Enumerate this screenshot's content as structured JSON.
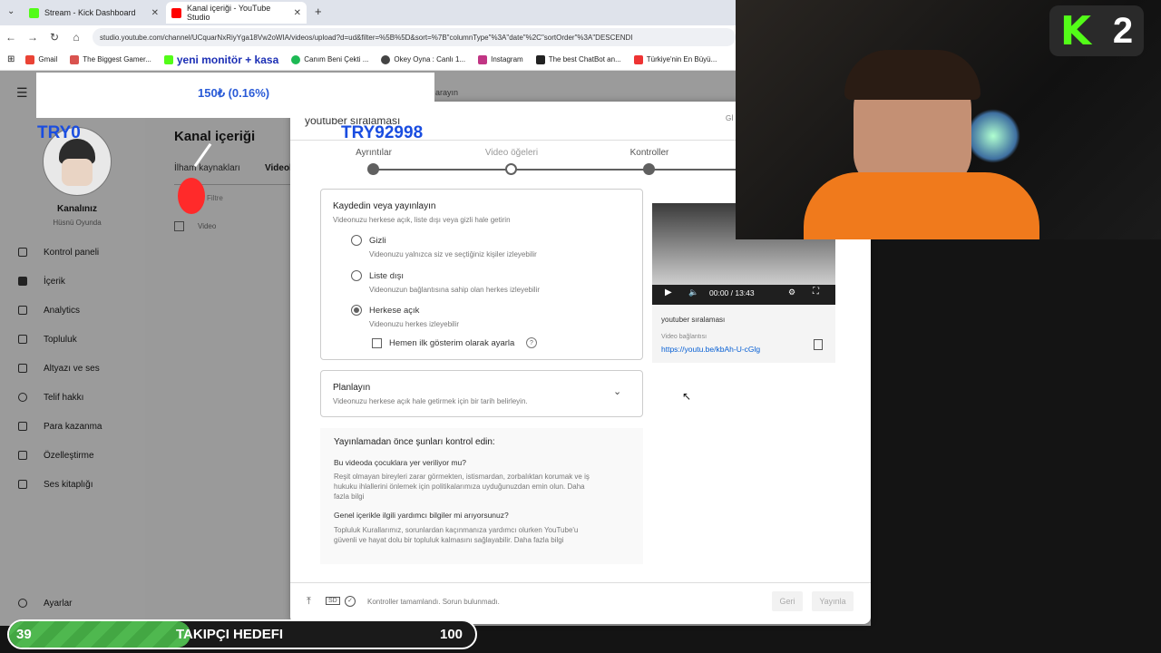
{
  "tabs": [
    {
      "label": "Stream - Kick Dashboard",
      "color": "#53fc18"
    },
    {
      "label": "Kanal içeriği - YouTube Studio",
      "color": "#ff0000"
    }
  ],
  "address": "studio.youtube.com/channel/UCquarNxRiyYga18Vw2oWIA/videos/upload?d=ud&filter=%5B%5D&sort=%7B\"columnType\"%3A\"date\"%2C\"sortOrder\"%3A\"DESCENDI",
  "bookmarks": [
    "Gmail",
    "The Biggest Gamer...",
    "yeni monitör + kasa",
    "Canım Beni Çekti ...",
    "Okey Oyna : Canlı 1...",
    "Instagram",
    "The best ChatBot an...",
    "Türkiye'nin En Büyü..."
  ],
  "overlay": {
    "donation": "150₺ (0.16%)",
    "try_small": "TRY0",
    "try_big": "TRY92998"
  },
  "goal": {
    "current": "39",
    "label": "TAKIPÇI HEDEFI",
    "target": "100",
    "progress": 0.39
  },
  "channel": {
    "name": "Kanalınız",
    "handle": "Hüsnü Oyunda"
  },
  "studio": {
    "page_title": "Kanal içeriği",
    "tabs": [
      "İlham kaynakları",
      "Videol"
    ],
    "filter": "Filtre",
    "col_video": "Video",
    "search_hint": "arayın"
  },
  "sidebar": [
    {
      "label": "Kontrol paneli",
      "icon": "dashboard-icon"
    },
    {
      "label": "İçerik",
      "icon": "content-icon"
    },
    {
      "label": "Analytics",
      "icon": "analytics-icon"
    },
    {
      "label": "Topluluk",
      "icon": "community-icon"
    },
    {
      "label": "Altyazı ve ses",
      "icon": "subtitles-icon"
    },
    {
      "label": "Telif hakkı",
      "icon": "copyright-icon"
    },
    {
      "label": "Para kazanma",
      "icon": "money-icon"
    },
    {
      "label": "Özelleştirme",
      "icon": "customize-icon"
    },
    {
      "label": "Ses kitaplığı",
      "icon": "audio-library-icon"
    }
  ],
  "settings_label": "Ayarlar",
  "dialog": {
    "title": "youtuber sıralaması",
    "title_right": "Gİ",
    "steps": [
      "Ayrıntılar",
      "Video öğeleri",
      "Kontroller",
      ""
    ],
    "visibility": {
      "title": "Kaydedin veya yayınlayın",
      "subtitle": "Videonuzu herkese açık, liste dışı veya gizli hale getirin",
      "options": [
        {
          "label": "Gizli",
          "desc": "Videonuzu yalnızca siz ve seçtiğiniz kişiler izleyebilir"
        },
        {
          "label": "Liste dışı",
          "desc": "Videonuzun bağlantısına sahip olan herkes izleyebilir"
        },
        {
          "label": "Herkese açık",
          "desc": "Videonuzu herkes izleyebilir"
        }
      ],
      "premiere": "Hemen ilk gösterim olarak ayarla"
    },
    "schedule": {
      "title": "Planlayın",
      "desc": "Videonuzu herkese açık hale getirmek için bir tarih belirleyin."
    },
    "checks": {
      "title": "Yayınlamadan önce şunları kontrol edin:",
      "q1": "Bu videoda çocuklara yer veriliyor mu?",
      "a1": "Reşit olmayan bireyleri zarar görmekten, istismardan, zorbalıktan korumak ve iş hukuku ihlallerini önlemek için politikalarımıza uyduğunuzdan emin olun. Daha fazla bilgi",
      "q2": "Genel içerikle ilgili yardımcı bilgiler mi arıyorsunuz?",
      "a2": "Topluluk Kurallarımız, sorunlardan kaçınmanıza yardımcı olurken YouTube'u güvenli ve hayat dolu bir topluluk kalmasını sağlayabilir. Daha fazla bilgi"
    },
    "preview": {
      "time": "00:00 / 13:43",
      "filename": "youtuber sıralaması",
      "link_label": "Video bağlantısı",
      "link": "https://youtu.be/kbAh-U-cGlg"
    },
    "footer": {
      "status": "Kontroller tamamlandı. Sorun bulunmadı.",
      "back": "Geri",
      "publish": "Yayınla",
      "sd": "SD"
    }
  },
  "cam_logo": {
    "k": "K",
    "n": "2"
  }
}
